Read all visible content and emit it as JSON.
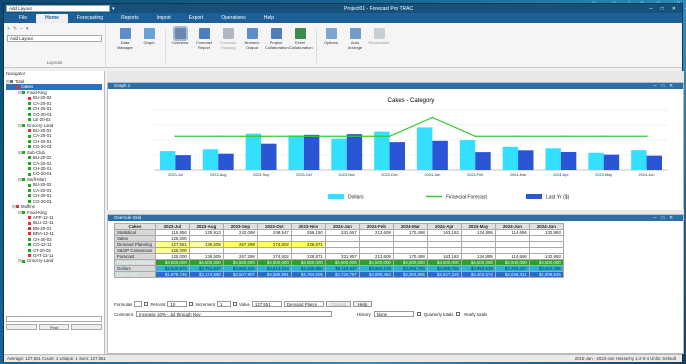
{
  "app": {
    "title": "Project01 - Forecast Pro TRAC",
    "layout": "Add Layout"
  },
  "menu": [
    "File",
    "Home",
    "Forecasting",
    "Reports",
    "Import",
    "Export",
    "Operations",
    "Help"
  ],
  "ribbon": {
    "layout_select": "Add Layout",
    "group_label": "Layouts",
    "buttons": [
      {
        "label": "Data Manager",
        "icon": "data-manager-icon",
        "color": "#5b8fc7"
      },
      {
        "label": "Graph",
        "icon": "graph-icon",
        "color": "#6aa0d8"
      },
      {
        "label": "Overview",
        "icon": "overview-icon",
        "color": "#6b86b0"
      },
      {
        "label": "Forecast Report",
        "icon": "forecast-report-icon",
        "color": "#4a7fc0"
      },
      {
        "label": "Forecast Tracking",
        "icon": "forecast-tracking-icon",
        "color": "#b0b8c4"
      },
      {
        "label": "Numeric Output",
        "icon": "numeric-output-icon",
        "color": "#5a90c8"
      },
      {
        "label": "Project Collaboration",
        "icon": "project-collaboration-icon",
        "color": "#4f7db5"
      },
      {
        "label": "Excel Collaboration",
        "icon": "excel-collaboration-icon",
        "color": "#3d8a4d"
      },
      {
        "label": "Options",
        "icon": "options-icon",
        "color": "#7aa6d0"
      },
      {
        "label": "Auto Arrange",
        "icon": "auto-arrange-icon",
        "color": "#6f9ccc"
      },
      {
        "label": "Recalculate",
        "icon": "recalculate-icon",
        "color": "#c8ced6"
      }
    ]
  },
  "navigator": {
    "label": "Navigator",
    "items": [
      {
        "label": "Total",
        "depth": 0,
        "color": "#777"
      },
      {
        "label": "Cakes",
        "depth": 1,
        "color": "#d33",
        "selected": true
      },
      {
        "label": "Food-King",
        "depth": 2,
        "color": "#2a2"
      },
      {
        "label": "BU-20-02",
        "depth": 3,
        "color": "#d33"
      },
      {
        "label": "CA-20-01",
        "depth": 3,
        "color": "#2a2"
      },
      {
        "label": "CH-20-01",
        "depth": 3,
        "color": "#2a2"
      },
      {
        "label": "CO-20-01",
        "depth": 3,
        "color": "#2a2"
      },
      {
        "label": "LE-20-02",
        "depth": 3,
        "color": "#2a2"
      },
      {
        "label": "Grocery-Land",
        "depth": 2,
        "color": "#2a2"
      },
      {
        "label": "BU-20-02",
        "depth": 3,
        "color": "#d33"
      },
      {
        "label": "CA-20-01",
        "depth": 3,
        "color": "#2a2"
      },
      {
        "label": "CH-20-01",
        "depth": 3,
        "color": "#2a2"
      },
      {
        "label": "CO-20-01",
        "depth": 3,
        "color": "#2a2"
      },
      {
        "label": "Sub-Club",
        "depth": 2,
        "color": "#2a2"
      },
      {
        "label": "BU-20-02",
        "depth": 3,
        "color": "#2a2"
      },
      {
        "label": "CA-20-01",
        "depth": 3,
        "color": "#2a2"
      },
      {
        "label": "CH-20-01",
        "depth": 3,
        "color": "#2a2"
      },
      {
        "label": "CO-20-01",
        "depth": 3,
        "color": "#2a2"
      },
      {
        "label": "Stuff-Mart",
        "depth": 2,
        "color": "#2a2"
      },
      {
        "label": "BU-20-02",
        "depth": 3,
        "color": "#2a2"
      },
      {
        "label": "CA-20-01",
        "depth": 3,
        "color": "#2a2"
      },
      {
        "label": "CH-20-01",
        "depth": 3,
        "color": "#2a2"
      },
      {
        "label": "CO-20-01",
        "depth": 3,
        "color": "#2a2"
      },
      {
        "label": "Muffins",
        "depth": 1,
        "color": "#d33"
      },
      {
        "label": "Food-King",
        "depth": 2,
        "color": "#2a2"
      },
      {
        "label": "APP-12-11",
        "depth": 3,
        "color": "#d33"
      },
      {
        "label": "BLU-12-11",
        "depth": 3,
        "color": "#d33"
      },
      {
        "label": "BN-20-01",
        "depth": 3,
        "color": "#d33"
      },
      {
        "label": "BRA-12-11",
        "depth": 3,
        "color": "#d33"
      },
      {
        "label": "CH-20-02",
        "depth": 3,
        "color": "#2a2"
      },
      {
        "label": "CO-12-11",
        "depth": 3,
        "color": "#2a2"
      },
      {
        "label": "CT-20-02",
        "depth": 3,
        "color": "#2a2"
      },
      {
        "label": "OAT-12-11",
        "depth": 3,
        "color": "#d33"
      },
      {
        "label": "Grocery-Land",
        "depth": 2,
        "color": "#2a2"
      }
    ],
    "find_label": "Find"
  },
  "graph_panel": {
    "title": "Graph 1"
  },
  "grid_panel": {
    "title": "Override Grid"
  },
  "chart_data": {
    "type": "bar",
    "title": "Cakes - Category",
    "categories": [
      "2023-Jul",
      "2023-Aug",
      "2023-Sep",
      "2023-Oct",
      "2023-Nov",
      "2023-Dec",
      "2024-Jan",
      "2024-Feb",
      "2024-Mar",
      "2024-Apr",
      "2024-May",
      "2024-Jun"
    ],
    "x_tick_labels": [
      "2023-Jul",
      "2023-Aug",
      "2023-Sep",
      "2023-Oct",
      "2023-Nov",
      "2023-Dec",
      "2024-Jan",
      "2024-Feb",
      "2024-Mar",
      "2024-Apr",
      "2024-May",
      "2024-Jun"
    ],
    "series": [
      {
        "name": "Dollars",
        "type": "bar",
        "color": "#33e0ff",
        "values": [
          2520976,
          2761827,
          4846225,
          4613243,
          4185850,
          5119927,
          5684219,
          3990750,
          3085755,
          2893529,
          2293267,
          2652495
        ]
      },
      {
        "name": "Financial Forecast",
        "type": "line",
        "color": "#33cc33",
        "values": [
          4500000,
          4500000,
          4500000,
          4500000,
          4500000,
          4500000,
          7000000,
          4500000,
          4500000,
          4500000,
          4500000,
          4500000
        ]
      },
      {
        "name": "Last Yr ($)",
        "type": "bar",
        "color": "#2a55d4",
        "values": [
          1978746,
          2174580,
          3507907,
          4689991,
          4784005,
          3720787,
          3889454,
          2383895,
          2627225,
          2403574,
          2048321,
          1908845
        ]
      }
    ],
    "ylim": [
      0,
      8000000
    ]
  },
  "grid": {
    "corner": "Cakes",
    "columns": [
      "2023-Jul",
      "2023-Aug",
      "2023-Sep",
      "2023-Oct",
      "2023-Nov",
      "2024-Jan",
      "2024-Feb",
      "2024-Mar",
      "2024-Apr",
      "2024-May",
      "2024-Jun"
    ],
    "rows": [
      {
        "label": "Statistical",
        "cls": "",
        "cells": [
          "115,956",
          "125,913",
          "242,098",
          "248,547",
          "256,150",
          "331,657",
          "213,609",
          "170,498",
          "163,182",
          "134,895",
          "114,696",
          "132,993"
        ]
      },
      {
        "label": "Sales",
        "cls": "",
        "cells": [
          "125,000",
          "",
          "",
          "",
          "",
          "",
          "",
          "",
          "",
          "",
          "",
          ""
        ]
      },
      {
        "label": "Demand Planning",
        "cls": "dp",
        "cells": [
          "127,551",
          "136,505",
          "267,298",
          "274,502",
          "228,871",
          "",
          "",
          "",
          "",
          "",
          "",
          ""
        ]
      },
      {
        "label": "S&OP Consensus",
        "cls": "sop",
        "cells": [
          "125,000",
          "",
          "",
          "",
          "",
          "",
          "",
          "",
          "",
          "",
          "",
          ""
        ]
      },
      {
        "label": "Forecast",
        "cls": "",
        "cells": [
          "125,000",
          "136,505",
          "267,298",
          "274,502",
          "228,871",
          "331,957",
          "213,609",
          "170,498",
          "163,182",
          "134,895",
          "114,696",
          "132,993"
        ]
      },
      {
        "label": "Financial Forecast",
        "cls": "ff",
        "cells": [
          "$4,500,000",
          "$4,500,000",
          "$4,500,000",
          "$4,500,000",
          "$4,500,000",
          "$4,500,000",
          "$4,500,000",
          "$4,500,000",
          "$4,500,000",
          "$4,500,000",
          "$4,500,000",
          "$4,500,000"
        ]
      },
      {
        "label": "Dollars",
        "cls": "dol",
        "cells": [
          "$2,520,976",
          "$2,761,827",
          "$4,846,225",
          "$4,613,243",
          "$4,185,850",
          "$5,119,927",
          "$3,684,219",
          "$3,090,750",
          "$3,085,755",
          "$2,893,529",
          "$2,293,267",
          "$2,652,495"
        ]
      },
      {
        "label": "Last Yr ($)",
        "cls": "ly",
        "cells": [
          "$1,978,746",
          "$2,174,580",
          "$3,507,907",
          "$4,689,991",
          "$4,784,005",
          "$3,720,787",
          "$3,889,454",
          "$2,383,895",
          "$2,627,225",
          "$2,403,574",
          "$2,048,321",
          "$1,908,845"
        ]
      }
    ],
    "header_cols": [
      "2023-Jul",
      "2023-Aug",
      "2023-Sep",
      "2023-Oct",
      "2023-Nov",
      "2024-Jan",
      "2024-Feb",
      "2024-Mar",
      "2024-Apr",
      "2024-May",
      "2024-Jun",
      "2024-Jun"
    ]
  },
  "formula_bar": {
    "formulas_label": "Formulas",
    "percent_label": "Percent",
    "percent_value": "10",
    "increment_label": "Increment",
    "increment_value": "1",
    "value_label": "Value",
    "value_value": "127,551",
    "target": "Demand Planni",
    "commit": "Commit",
    "help": "Help",
    "comment_label": "Comment",
    "comment_value": "Increase 10% - Jul through Nov",
    "history_label": "History",
    "history_value": "None",
    "quarterly": "Quarterly totals",
    "yearly": "Yearly totals"
  },
  "status": {
    "left": "Average: 127,551 Count: 1 Unique: 1 Sum: 127,551",
    "right": "2016-Jan - 2023-Jun   Hierarchy 1-2-3-4   Units: Default"
  }
}
